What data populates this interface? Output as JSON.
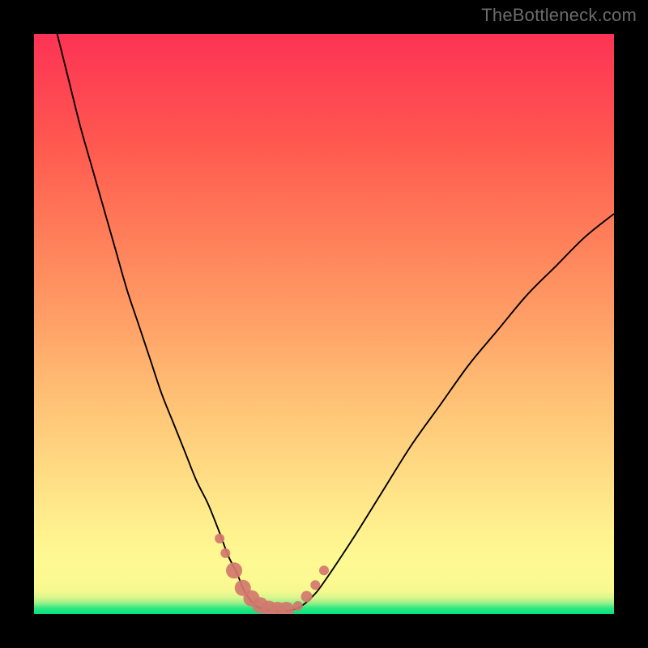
{
  "watermark": "TheBottleneck.com",
  "chart_data": {
    "type": "line",
    "title": "",
    "xlabel": "",
    "ylabel": "",
    "xlim": [
      0,
      100
    ],
    "ylim": [
      0,
      100
    ],
    "grid": false,
    "legend": false,
    "background_gradient": {
      "direction": "vertical_bottom_to_top",
      "stops": [
        {
          "pos": 0,
          "color": "#05e27e"
        },
        {
          "pos": 5,
          "color": "#f7f890"
        },
        {
          "pos": 15,
          "color": "#fff28f"
        },
        {
          "pos": 50,
          "color": "#ffa167"
        },
        {
          "pos": 100,
          "color": "#fd3355"
        }
      ]
    },
    "series": [
      {
        "name": "bottleneck-curve",
        "kind": "line",
        "color": "#000000",
        "x": [
          4,
          6,
          8,
          10,
          12,
          14,
          16,
          18,
          20,
          22,
          24,
          26,
          28,
          30,
          32,
          33.5,
          35,
          36,
          37,
          38,
          39,
          40,
          42,
          44,
          46,
          48,
          50,
          55,
          60,
          65,
          70,
          75,
          80,
          85,
          90,
          95,
          100
        ],
        "y": [
          100,
          92,
          84,
          77,
          70,
          63,
          56,
          50,
          44,
          38,
          33,
          28,
          23,
          19,
          14,
          10,
          7,
          4.5,
          2.8,
          1.6,
          1.0,
          0.7,
          0.5,
          0.6,
          1.3,
          3.0,
          5.5,
          13,
          21,
          29,
          36,
          43,
          49,
          55,
          60,
          65,
          69
        ]
      },
      {
        "name": "near-min-markers",
        "kind": "scatter",
        "color": "#d4776e",
        "x": [
          32.0,
          33.0,
          34.5,
          36.0,
          37.5,
          39.0,
          40.5,
          42.0,
          43.5,
          45.5,
          47.0,
          48.5,
          50.0
        ],
        "y": [
          13.0,
          10.5,
          7.5,
          4.5,
          2.7,
          1.5,
          0.9,
          0.7,
          0.7,
          1.4,
          3.0,
          5.0,
          7.5
        ],
        "size": [
          6,
          6,
          10,
          10,
          10,
          10,
          10,
          10,
          10,
          6,
          7,
          6,
          6
        ]
      }
    ],
    "annotations": []
  }
}
